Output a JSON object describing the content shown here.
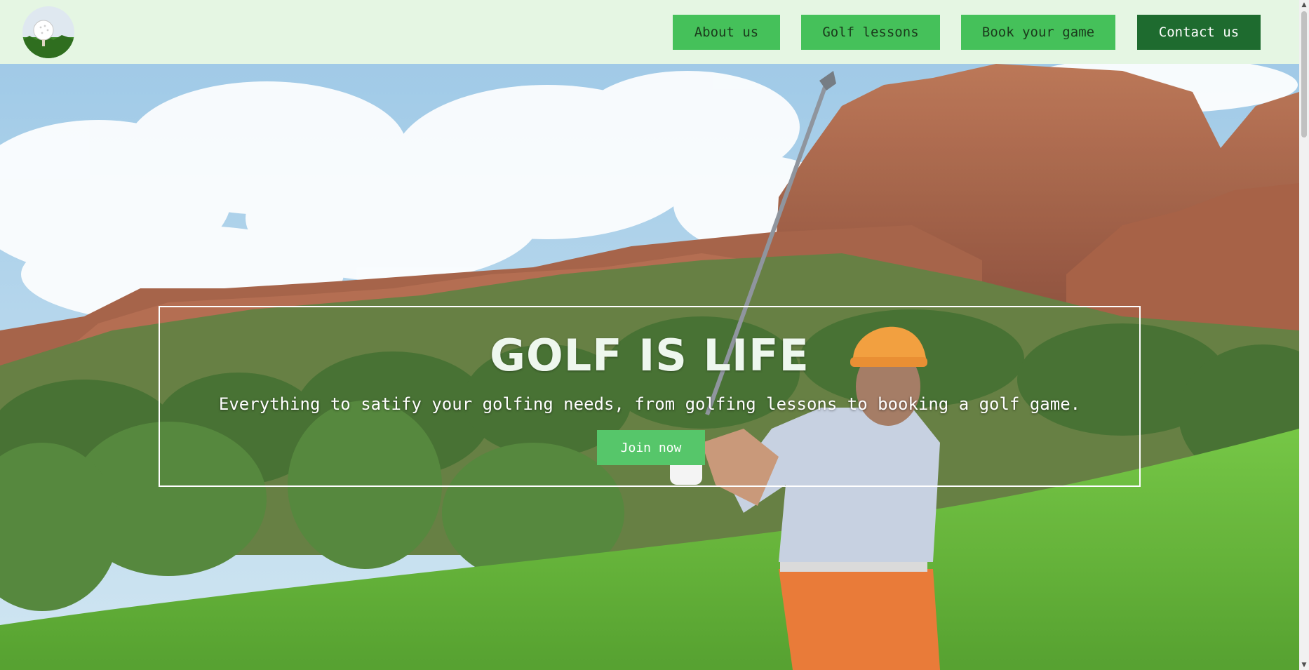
{
  "nav": {
    "logo_icon": "golf-ball-on-tee-icon",
    "items": [
      {
        "label": "About us"
      },
      {
        "label": "Golf lessons"
      },
      {
        "label": "Book your game"
      },
      {
        "label": "Contact us"
      }
    ]
  },
  "hero": {
    "title": "GOLF IS LIFE",
    "subtitle": "Everything to satify your golfing needs, from golfing lessons to booking a golf game.",
    "cta_label": "Join now",
    "image": "golfer-swinging-on-fairway-with-red-rock-cliffs"
  },
  "colors": {
    "nav_background": "#e5f6e3",
    "nav_button": "#45c15a",
    "nav_button_active": "#1e6b2f",
    "cta_button": "#56c66a"
  },
  "scrollbar": {
    "up_icon": "chevron-up-icon",
    "down_icon": "chevron-down-icon"
  }
}
